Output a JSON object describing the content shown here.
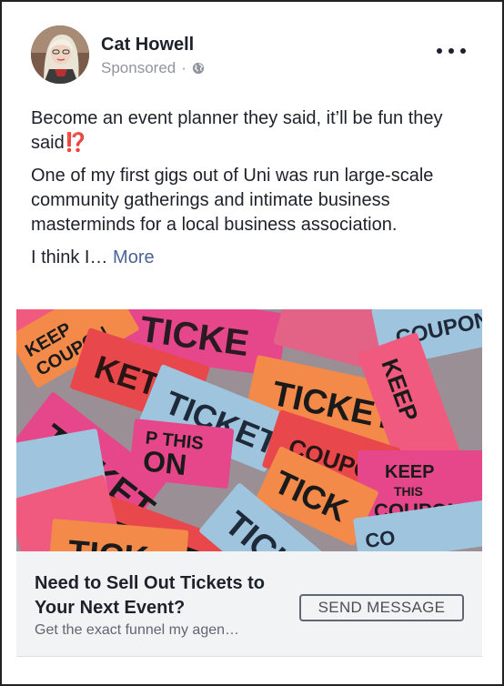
{
  "post": {
    "author_name": "Cat Howell",
    "sponsored_label": "Sponsored",
    "separator": "·",
    "paragraphs": [
      "Become an event planner they said, it’ll be fun they said",
      "One of my first gigs out of Uni was run large-scale community gatherings and intimate business masterminds for a local business association.",
      "I think I…"
    ],
    "emoji": "⁉️",
    "see_more_label": "More"
  },
  "ad": {
    "headline": "Need to Sell Out Tickets to Your Next Event?",
    "description": "Get the exact funnel my agen…",
    "cta_label": "SEND MESSAGE",
    "image_ticket_words": [
      "TICKET",
      "TICKET",
      "TICKET",
      "TICKET",
      "TICKET",
      "TICKET",
      "TICKET",
      "TICKET",
      "TICKET"
    ],
    "image_keep_words": [
      "KEEP",
      "THIS",
      "COUPON"
    ]
  },
  "icons": {
    "globe": "globe-icon",
    "more": "more-options-icon"
  },
  "colors": {
    "link": "#4b6495",
    "meta_gray": "#90949c",
    "cta_background": "#f2f3f5"
  }
}
